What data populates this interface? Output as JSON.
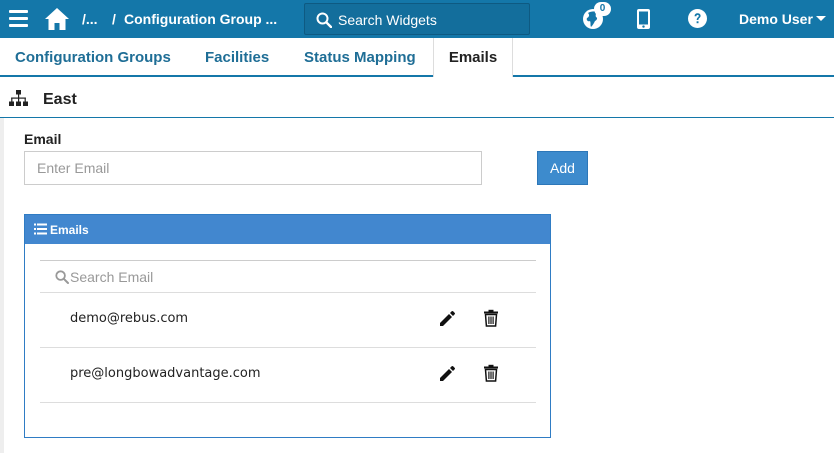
{
  "topbar": {
    "breadcrumb_ellipsis": "/...",
    "breadcrumb_separator": "/",
    "breadcrumb_current": "Configuration Group ...",
    "search_placeholder": "Search Widgets",
    "notification_count": "0",
    "user_name": "Demo User",
    "icons": [
      "hamburger-menu-icon",
      "home-icon",
      "search-icon",
      "globe-icon",
      "mobile-icon",
      "help-icon",
      "caret-down-icon"
    ]
  },
  "tabs": [
    {
      "label": "Configuration Groups",
      "active": false
    },
    {
      "label": "Facilities",
      "active": false
    },
    {
      "label": "Status Mapping",
      "active": false
    },
    {
      "label": "Emails",
      "active": true
    }
  ],
  "section": {
    "title": "East",
    "icon": "org-chart-icon"
  },
  "form": {
    "email_label": "Email",
    "email_placeholder": "Enter Email",
    "email_value": "",
    "add_label": "Add"
  },
  "emails_panel": {
    "title": "Emails",
    "search_placeholder": "Search Email",
    "items": [
      {
        "email": "demo@rebus.com"
      },
      {
        "email": "pre@longbowadvantage.com"
      }
    ]
  },
  "colors": {
    "brand": "#1477a9",
    "button": "#3d8bcd",
    "panel_header": "#4287cf"
  }
}
